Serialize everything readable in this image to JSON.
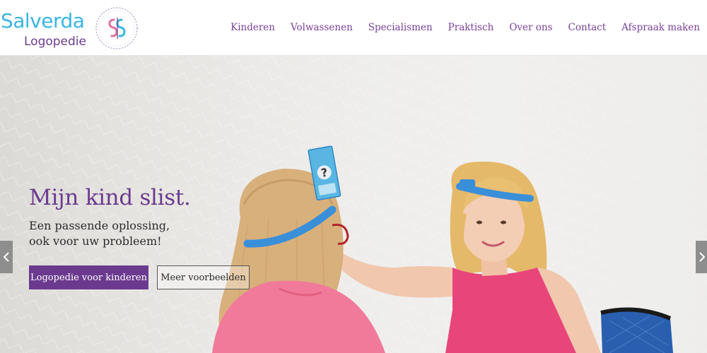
{
  "logo": {
    "line1": "Salverda",
    "line2": "Logopedie",
    "emblem_icon": "ss-monogram-icon",
    "colors": {
      "blue": "#3ab5e6",
      "purple": "#6b3a8f"
    }
  },
  "nav": {
    "items": [
      {
        "label": "Kinderen"
      },
      {
        "label": "Volwassenen"
      },
      {
        "label": "Specialismen"
      },
      {
        "label": "Praktisch"
      },
      {
        "label": "Over ons"
      },
      {
        "label": "Contact"
      },
      {
        "label": "Afspraak maken"
      }
    ]
  },
  "hero": {
    "headline": "Mijn kind slist.",
    "subline_1": "Een passende oplossing,",
    "subline_2": "ook voor uw probleem!",
    "primary_button": "Logopedie voor kinderen",
    "secondary_button": "Meer voorbeelden",
    "prev_icon": "chevron-left-icon",
    "next_icon": "chevron-right-icon",
    "image_subject": "photo-girl-and-therapist-headband-game"
  },
  "colors": {
    "accent_purple": "#6b3a8f",
    "nav_text": "#7a3f99",
    "headband_blue": "#3a8fd9",
    "shirt_pink": "#e8467a"
  }
}
